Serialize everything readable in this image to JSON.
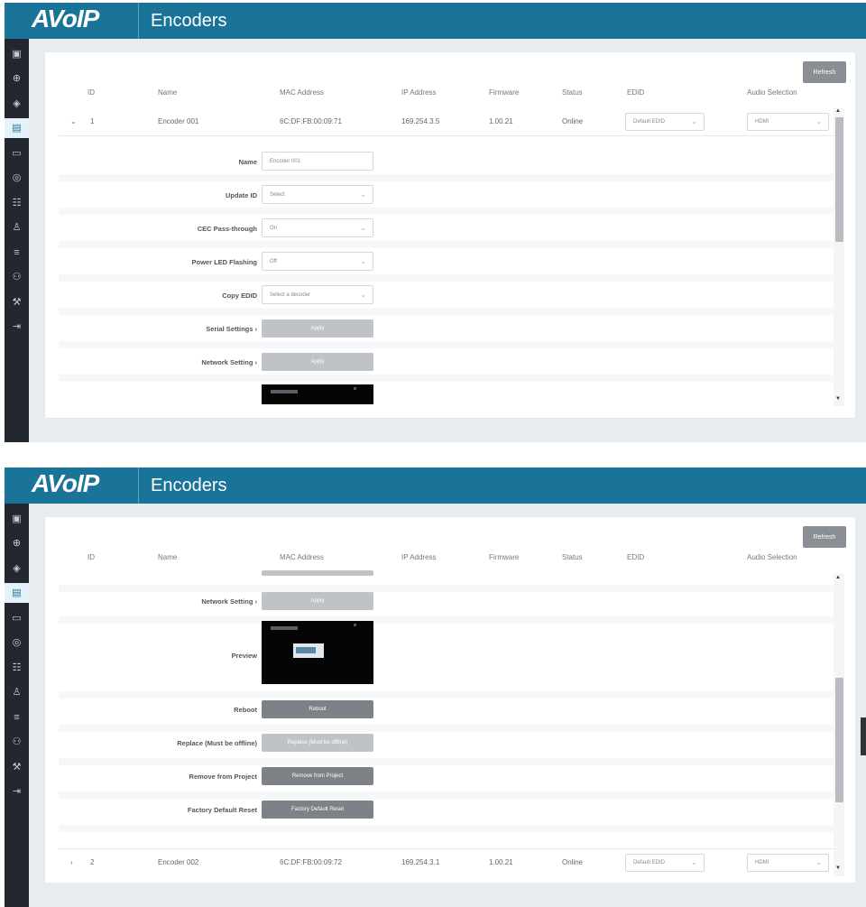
{
  "app": {
    "logo": "AVoIP",
    "title": "Encoders"
  },
  "nav_icons": [
    "dashboard-icon",
    "globe-icon",
    "layers-icon",
    "encoder-icon",
    "display-icon",
    "database-icon",
    "grid-icon",
    "user-icon",
    "sliders-icon",
    "users-icon",
    "wrench-icon",
    "logout-icon"
  ],
  "refresh_label": "Refresh",
  "columns": [
    "ID",
    "Name",
    "MAC Address",
    "IP Address",
    "Firmware",
    "Status",
    "EDID",
    "Audio Selection"
  ],
  "encoders": [
    {
      "id": "1",
      "name": "Encoder 001",
      "mac": "6C:DF:FB:00:09:71",
      "ip": "169.254.3.5",
      "firmware": "1.00.21",
      "status": "Online",
      "edid": "Default EDID",
      "audio": "HDMI"
    },
    {
      "id": "2",
      "name": "Encoder 002",
      "mac": "6C:DF:FB:00:09:72",
      "ip": "169.254.3.1",
      "firmware": "1.00.21",
      "status": "Online",
      "edid": "Default EDID",
      "audio": "HDMI"
    }
  ],
  "form": {
    "name_label": "Name",
    "name_value": "Encoder 001",
    "update_id_label": "Update ID",
    "update_id_placeholder": "Select",
    "cec_label": "CEC Pass-through",
    "cec_value": "On",
    "power_led_label": "Power LED Flashing",
    "power_led_value": "Off",
    "copy_edid_label": "Copy EDID",
    "copy_edid_placeholder": "Select a decoder",
    "serial_label": "Serial Settings",
    "network_label": "Network Setting",
    "apply_label": "Apply",
    "preview_label": "Preview",
    "reboot_label": "Reboot",
    "reboot_button": "Reboot",
    "replace_label": "Replace (Must be offline)",
    "replace_button": "Replace (Must be offline)",
    "remove_label": "Remove from Project",
    "remove_button": "Remove from Project",
    "factory_label": "Factory Default Reset",
    "factory_button": "Factory Default Reset"
  },
  "glyphs": {
    "expanded": "⌄",
    "collapsed": "›",
    "chevron": "⌄",
    "caret_right": "›",
    "scroll_up": "▲",
    "scroll_down": "▼"
  }
}
